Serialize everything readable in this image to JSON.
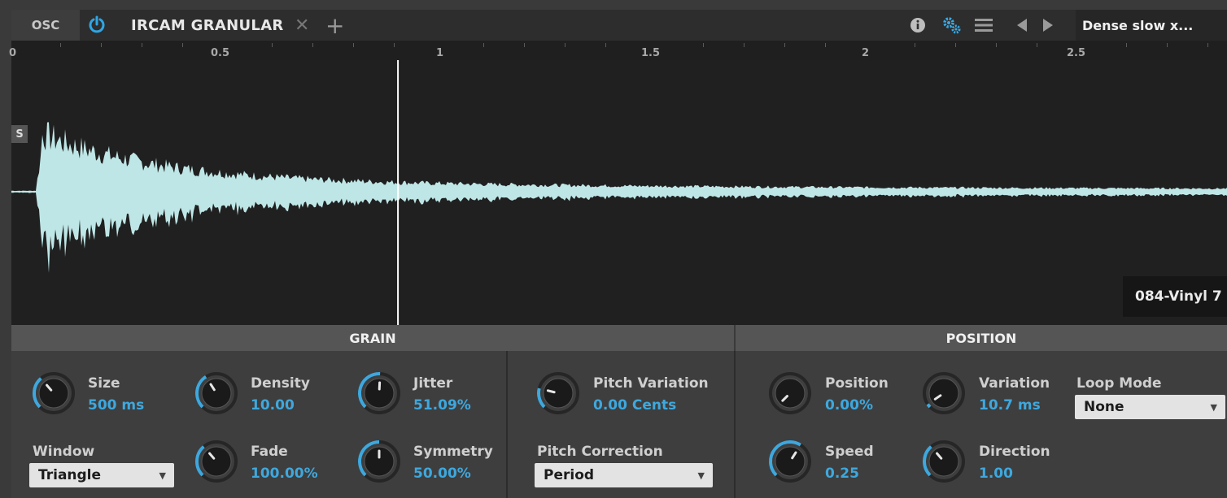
{
  "header": {
    "osc_tab": "OSC",
    "device_name": "IRCAM GRANULAR",
    "preset_name": "Dense slow x...",
    "icons": [
      "power-icon",
      "close-icon",
      "plus-icon",
      "info-icon",
      "gears-icon",
      "menu-icon",
      "previous-icon",
      "next-icon"
    ]
  },
  "ruler": {
    "labels": [
      "0",
      "0.5",
      "1",
      "1.5",
      "2",
      "2.5"
    ]
  },
  "waveform": {
    "solo_button": "S",
    "sample_name": "084-Vinyl 7",
    "wave_color": "#bfe6e6",
    "playhead_position": 0.318
  },
  "grain": {
    "title": "GRAIN",
    "size": {
      "label": "Size",
      "value": "500 ms",
      "level": 0.35
    },
    "density": {
      "label": "Density",
      "value": "10.00",
      "level": 0.38
    },
    "jitter": {
      "label": "Jitter",
      "value": "51.09%",
      "level": 0.51
    },
    "window": {
      "label": "Window",
      "value": "Triangle"
    },
    "fade": {
      "label": "Fade",
      "value": "100.00%",
      "level": 0.35
    },
    "symmetry": {
      "label": "Symmetry",
      "value": "50.00%",
      "level": 0.5
    },
    "pitch_variation": {
      "label": "Pitch Variation",
      "value": "0.00 Cents",
      "level": 0.22
    },
    "pitch_correction": {
      "label": "Pitch Correction",
      "value": "Period"
    }
  },
  "position": {
    "title": "POSITION",
    "position": {
      "label": "Position",
      "value": "0.00%",
      "level": 0.0
    },
    "variation": {
      "label": "Variation",
      "value": "10.7 ms",
      "level": 0.04
    },
    "loop_mode": {
      "label": "Loop Mode",
      "value": "None"
    },
    "speed": {
      "label": "Speed",
      "value": "0.25",
      "level": 0.62
    },
    "direction": {
      "label": "Direction",
      "value": "1.00",
      "level": 0.35
    }
  },
  "colors": {
    "accent": "#3ea8de",
    "panel": "#3e3e3e",
    "header": "#555555"
  }
}
